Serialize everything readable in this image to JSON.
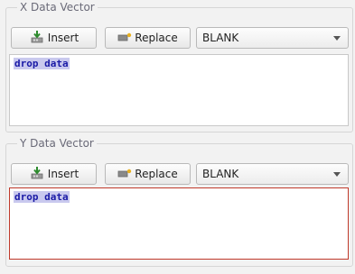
{
  "x_vector": {
    "title": "X Data Vector",
    "insert_label": "Insert",
    "replace_label": "Replace",
    "select_value": "BLANK",
    "drop_text": "drop data"
  },
  "y_vector": {
    "title": "Y Data Vector",
    "insert_label": "Insert",
    "replace_label": "Replace",
    "select_value": "BLANK",
    "drop_text": "drop data"
  },
  "icons": {
    "insert": "insert-icon",
    "replace": "replace-icon",
    "dropdown": "chevron-down-icon"
  },
  "colors": {
    "active_border": "#c0392b",
    "drop_text": "#1a1aa6",
    "drop_text_highlight": "#c9c9ee"
  }
}
